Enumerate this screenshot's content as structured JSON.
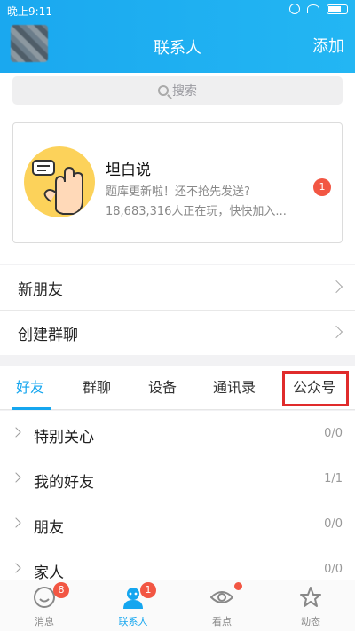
{
  "status": {
    "time": "晚上9:11"
  },
  "header": {
    "title": "联系人",
    "add_label": "添加"
  },
  "search": {
    "placeholder": "搜索"
  },
  "promo": {
    "title": "坦白说",
    "desc": "题库更新啦！还不抢先发送?",
    "count": "18,683,316人正在玩，快快加入...",
    "badge": "1"
  },
  "rows": {
    "new_friend": "新朋友",
    "create_group": "创建群聊"
  },
  "tabs": [
    "好友",
    "群聊",
    "设备",
    "通讯录",
    "公众号"
  ],
  "groups": [
    {
      "name": "特别关心",
      "count": "0/0"
    },
    {
      "name": "我的好友",
      "count": "1/1"
    },
    {
      "name": "朋友",
      "count": "0/0"
    },
    {
      "name": "家人",
      "count": "0/0"
    }
  ],
  "tabbar": [
    {
      "label": "消息",
      "badge": "8",
      "icon": "chat-bubble-icon"
    },
    {
      "label": "联系人",
      "badge": "1",
      "icon": "contacts-icon"
    },
    {
      "label": "看点",
      "icon": "eye-icon"
    },
    {
      "label": "动态",
      "icon": "star-icon"
    }
  ],
  "colors": {
    "accent": "#15a6ef",
    "badge": "#f25643",
    "highlight": "#e02b2b",
    "header": "#1aa8ef"
  }
}
